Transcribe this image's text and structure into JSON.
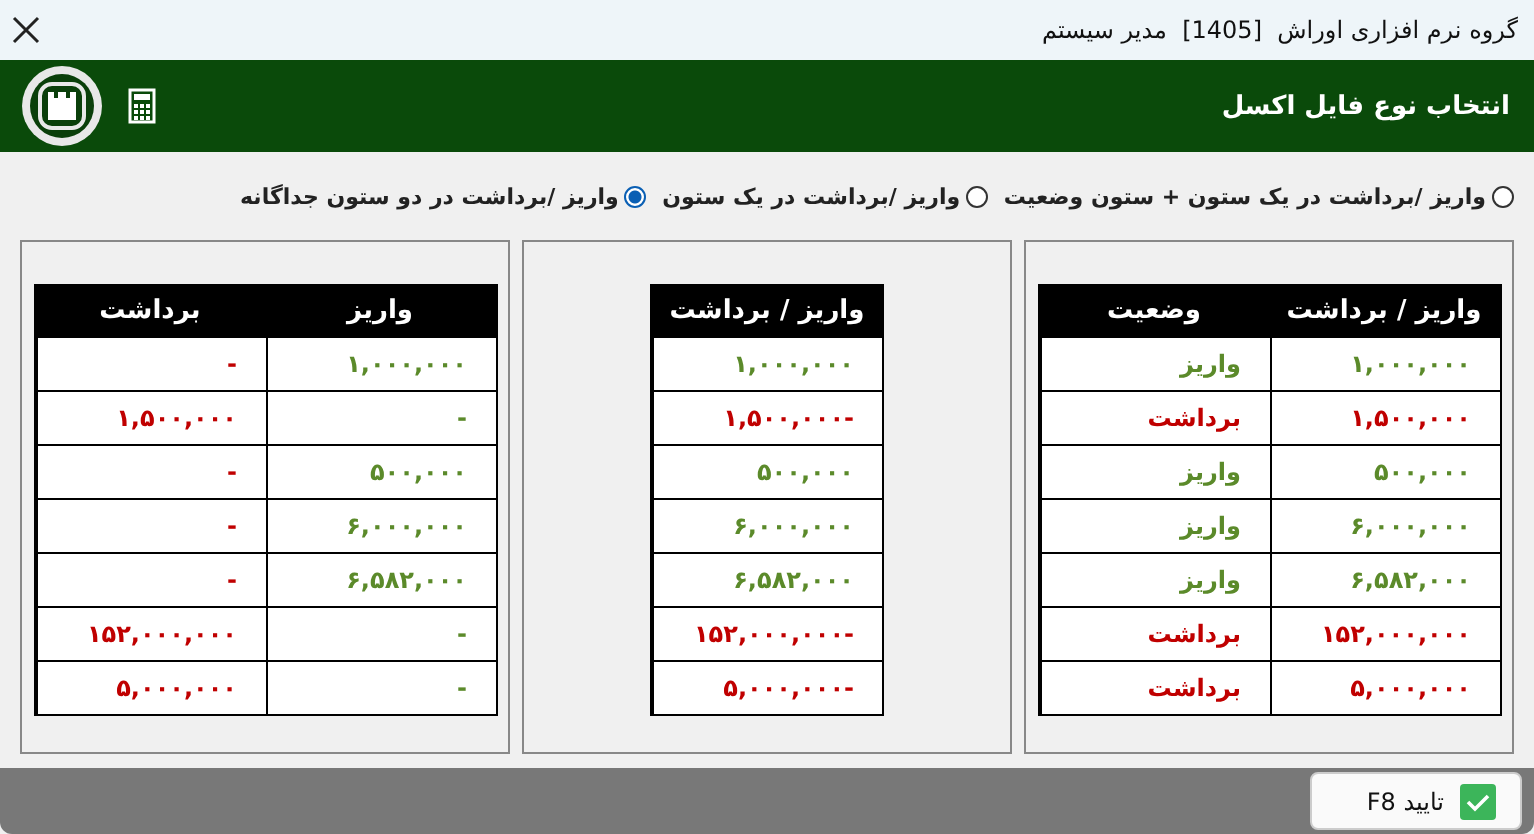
{
  "window": {
    "title": "گروه نرم افزاری اوراش  [1405]  مدیر سیستم"
  },
  "header": {
    "title": "انتخاب نوع فایل اکسل"
  },
  "options": [
    {
      "label": "واریز /برداشت در یک ستون + ستون وضعیت",
      "selected": false
    },
    {
      "label": "واریز /برداشت در یک ستون",
      "selected": false
    },
    {
      "label": "واریز /برداشت در دو ستون جداگانه",
      "selected": true
    }
  ],
  "panels": [
    {
      "columns": [
        "واریز / برداشت",
        "وضعیت"
      ],
      "rows": [
        [
          {
            "text": "۱,۰۰۰,۰۰۰",
            "kind": "deposit"
          },
          {
            "text": "واریز",
            "kind": "deposit"
          }
        ],
        [
          {
            "text": "۱,۵۰۰,۰۰۰",
            "kind": "withdrawal"
          },
          {
            "text": "برداشت",
            "kind": "withdrawal"
          }
        ],
        [
          {
            "text": "۵۰۰,۰۰۰",
            "kind": "deposit"
          },
          {
            "text": "واریز",
            "kind": "deposit"
          }
        ],
        [
          {
            "text": "۶,۰۰۰,۰۰۰",
            "kind": "deposit"
          },
          {
            "text": "واریز",
            "kind": "deposit"
          }
        ],
        [
          {
            "text": "۶,۵۸۲,۰۰۰",
            "kind": "deposit"
          },
          {
            "text": "واریز",
            "kind": "deposit"
          }
        ],
        [
          {
            "text": "۱۵۲,۰۰۰,۰۰۰",
            "kind": "withdrawal"
          },
          {
            "text": "برداشت",
            "kind": "withdrawal"
          }
        ],
        [
          {
            "text": "۵,۰۰۰,۰۰۰",
            "kind": "withdrawal"
          },
          {
            "text": "برداشت",
            "kind": "withdrawal"
          }
        ]
      ]
    },
    {
      "columns": [
        "واریز / برداشت"
      ],
      "rows": [
        [
          {
            "text": "۱,۰۰۰,۰۰۰",
            "kind": "deposit"
          }
        ],
        [
          {
            "text": "۱,۵۰۰,۰۰۰-",
            "kind": "withdrawal"
          }
        ],
        [
          {
            "text": "۵۰۰,۰۰۰",
            "kind": "deposit"
          }
        ],
        [
          {
            "text": "۶,۰۰۰,۰۰۰",
            "kind": "deposit"
          }
        ],
        [
          {
            "text": "۶,۵۸۲,۰۰۰",
            "kind": "deposit"
          }
        ],
        [
          {
            "text": "۱۵۲,۰۰۰,۰۰۰-",
            "kind": "withdrawal"
          }
        ],
        [
          {
            "text": "۵,۰۰۰,۰۰۰-",
            "kind": "withdrawal"
          }
        ]
      ]
    },
    {
      "columns": [
        "واریز",
        "برداشت"
      ],
      "rows": [
        [
          {
            "text": "۱,۰۰۰,۰۰۰",
            "kind": "deposit"
          },
          {
            "text": "-",
            "kind": "withdrawal"
          }
        ],
        [
          {
            "text": "-",
            "kind": "deposit"
          },
          {
            "text": "۱,۵۰۰,۰۰۰",
            "kind": "withdrawal"
          }
        ],
        [
          {
            "text": "۵۰۰,۰۰۰",
            "kind": "deposit"
          },
          {
            "text": "-",
            "kind": "withdrawal"
          }
        ],
        [
          {
            "text": "۶,۰۰۰,۰۰۰",
            "kind": "deposit"
          },
          {
            "text": "-",
            "kind": "withdrawal"
          }
        ],
        [
          {
            "text": "۶,۵۸۲,۰۰۰",
            "kind": "deposit"
          },
          {
            "text": "-",
            "kind": "withdrawal"
          }
        ],
        [
          {
            "text": "-",
            "kind": "deposit"
          },
          {
            "text": "۱۵۲,۰۰۰,۰۰۰",
            "kind": "withdrawal"
          }
        ],
        [
          {
            "text": "-",
            "kind": "deposit"
          },
          {
            "text": "۵,۰۰۰,۰۰۰",
            "kind": "withdrawal"
          }
        ]
      ]
    }
  ],
  "buttons": [
    {
      "label": "تایید F8"
    }
  ]
}
